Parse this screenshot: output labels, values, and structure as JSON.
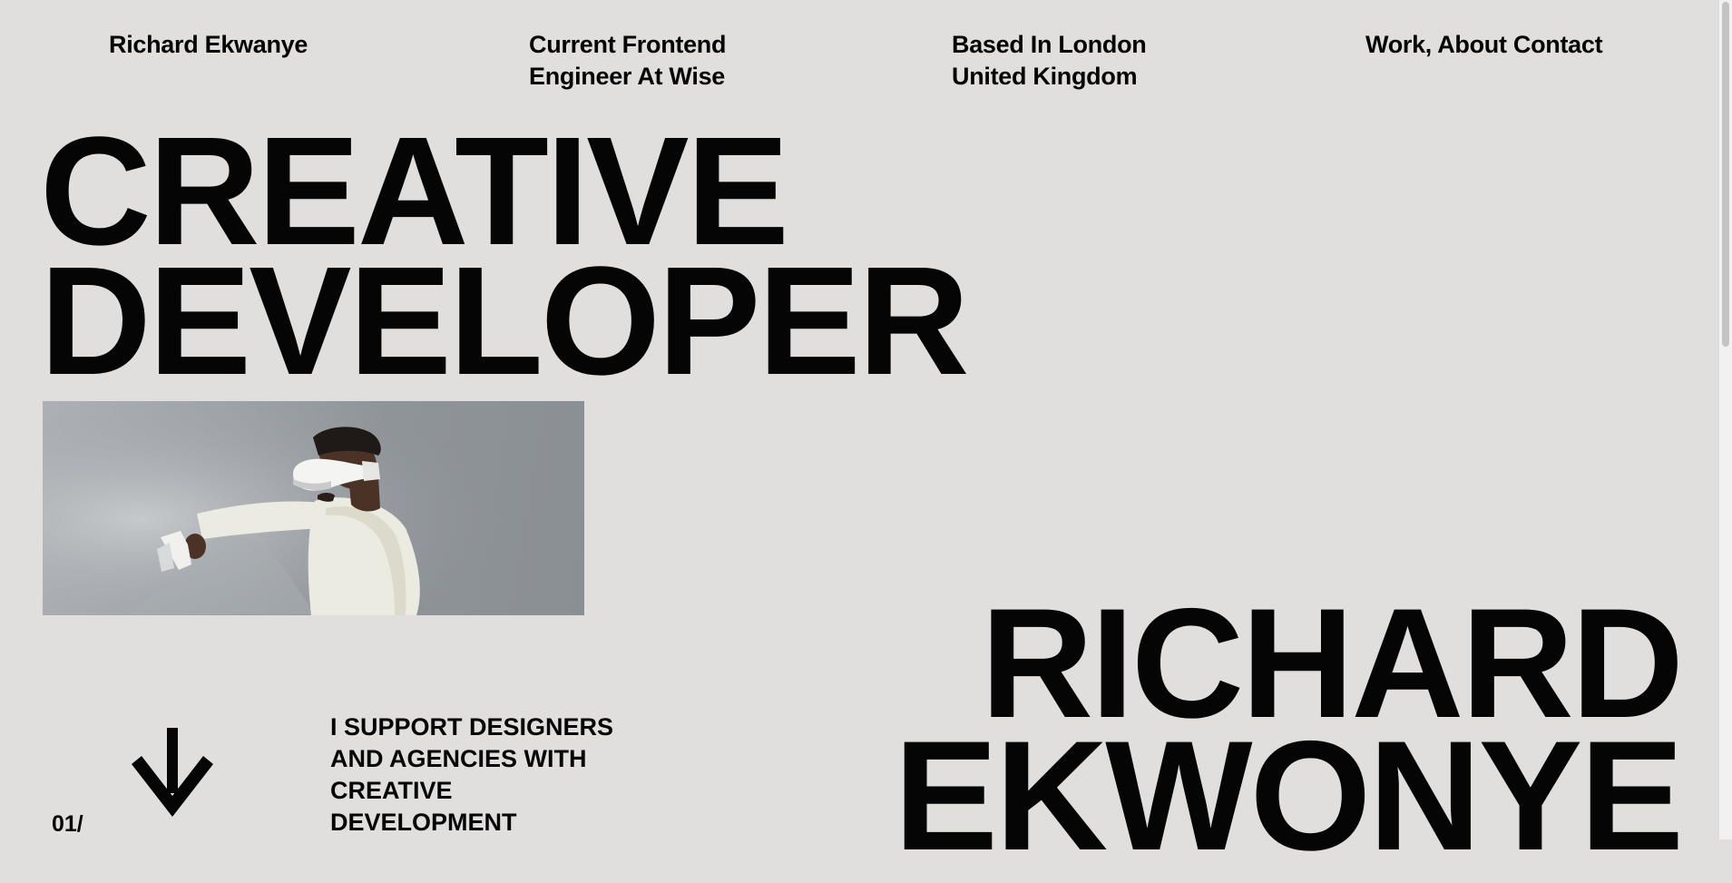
{
  "header": {
    "brand": "Richard Ekwanye",
    "role": [
      "Current Frontend",
      "Engineer At Wise"
    ],
    "location": [
      "Based In London",
      "United Kingdom"
    ],
    "nav": {
      "work": "Work,",
      "about": "About",
      "contact": "Contact"
    }
  },
  "hero": {
    "title": [
      "CREATIVE",
      "DEVELOPER"
    ],
    "image_icon": "vr-headset-person-photo"
  },
  "intro": {
    "section_number": "01/",
    "arrow_icon": "arrow-down-icon",
    "tagline": [
      "I SUPPORT DESIGNERS",
      "AND AGENCIES WITH",
      "CREATIVE",
      "DEVELOPMENT"
    ]
  },
  "name_block": [
    "RICHARD",
    "EKWONYE"
  ],
  "colors": {
    "background": "#e0dfde",
    "text": "#050505"
  }
}
